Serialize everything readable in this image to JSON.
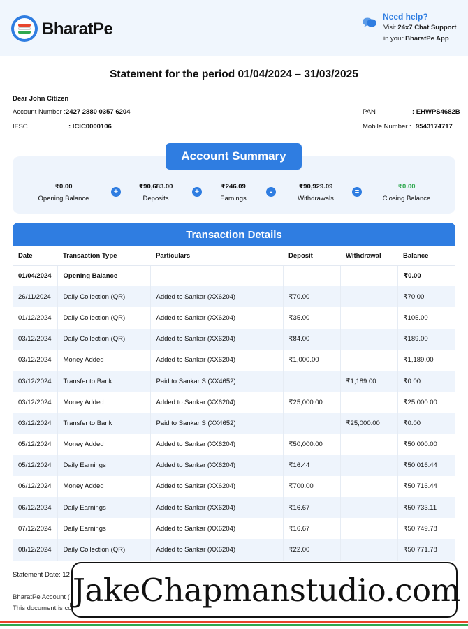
{
  "brand": {
    "name": "BharatPe"
  },
  "help": {
    "title": "Need help?",
    "visit": "Visit",
    "support": "24x7 Chat Support",
    "in_your": "in your",
    "app": "BharatPe App"
  },
  "statement": {
    "title": "Statement for the period 01/04/2024 – 31/03/2025"
  },
  "customer": {
    "greeting": "Dear John Citizen",
    "account_label": "Account Number :",
    "account_value": "2427 2880 0357 6204",
    "ifsc_label": "IFSC",
    "ifsc_value": ": ICIC0000106",
    "pan_label": "PAN",
    "pan_value": ": EHWPS4682B",
    "mobile_label": "Mobile  Number  :",
    "mobile_value": "9543174717"
  },
  "summary": {
    "title": "Account Summary",
    "items": [
      {
        "value": "₹0.00",
        "label": "Opening Balance"
      },
      {
        "value": "₹90,683.00",
        "label": "Deposits"
      },
      {
        "value": "₹246.09",
        "label": "Earnings"
      },
      {
        "value": "₹90,929.09",
        "label": "Withdrawals"
      },
      {
        "value": "₹0.00",
        "label": "Closing Balance"
      }
    ],
    "operators": [
      "+",
      "+",
      "-",
      "="
    ],
    "closing_color": "#2fa84f"
  },
  "transactions": {
    "title": "Transaction  Details",
    "columns": [
      "Date",
      "Transaction Type",
      "Particulars",
      "Deposit",
      "Withdrawal",
      "Balance"
    ],
    "rows": [
      [
        "01/04/2024",
        "Opening Balance",
        "",
        "",
        "",
        "₹0.00"
      ],
      [
        "26/11/2024",
        "Daily Collection (QR)",
        "Added to Sankar (XX6204)",
        "₹70.00",
        "",
        "₹70.00"
      ],
      [
        "01/12/2024",
        "Daily Collection (QR)",
        "Added to Sankar (XX6204)",
        "₹35.00",
        "",
        "₹105.00"
      ],
      [
        "03/12/2024",
        "Daily Collection (QR)",
        "Added to Sankar (XX6204)",
        "₹84.00",
        "",
        "₹189.00"
      ],
      [
        "03/12/2024",
        "Money Added",
        "Added to Sankar (XX6204)",
        "₹1,000.00",
        "",
        "₹1,189.00"
      ],
      [
        "03/12/2024",
        "Transfer to Bank",
        "Paid to Sankar S (XX4652)",
        "",
        "₹1,189.00",
        "₹0.00"
      ],
      [
        "03/12/2024",
        "Money Added",
        "Added to Sankar (XX6204)",
        "₹25,000.00",
        "",
        "₹25,000.00"
      ],
      [
        "03/12/2024",
        "Transfer to Bank",
        "Paid to Sankar S (XX4652)",
        "",
        "₹25,000.00",
        "₹0.00"
      ],
      [
        "05/12/2024",
        "Money Added",
        "Added to Sankar (XX6204)",
        "₹50,000.00",
        "",
        "₹50,000.00"
      ],
      [
        "05/12/2024",
        "Daily Earnings",
        "Added to Sankar (XX6204)",
        "₹16.44",
        "",
        "₹50,016.44"
      ],
      [
        "06/12/2024",
        "Money Added",
        "Added to Sankar (XX6204)",
        "₹700.00",
        "",
        "₹50,716.44"
      ],
      [
        "06/12/2024",
        "Daily Earnings",
        "Added to Sankar (XX6204)",
        "₹16.67",
        "",
        "₹50,733.11"
      ],
      [
        "07/12/2024",
        "Daily Earnings",
        "Added to Sankar (XX6204)",
        "₹16.67",
        "",
        "₹50,749.78"
      ],
      [
        "08/12/2024",
        "Daily Collection (QR)",
        "Added to Sankar (XX6204)",
        "₹22.00",
        "",
        "₹50,771.78"
      ]
    ]
  },
  "footer": {
    "statement_date": "Statement  Date:  12",
    "line1": "BharatPe Account (",
    "line2": "This document is co"
  },
  "watermark": {
    "text": "JakeChapmanstudio.com"
  },
  "colors": {
    "accent": "#2f7de1",
    "panel": "#eef4fc",
    "header_bg": "#f0f6fd",
    "red": "#e8452c",
    "green": "#2fa84f"
  }
}
